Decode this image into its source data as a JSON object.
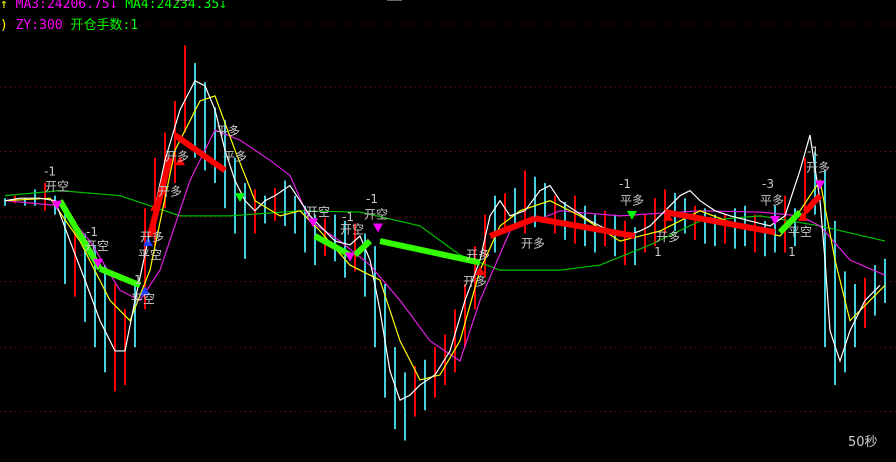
{
  "header": {
    "ma3_label": "MA3:24206.75",
    "ma3_arrow": "↓",
    "ma4_label": "MA4:24234.35",
    "ma4_arrow": "↓",
    "lead_arrow": "↑",
    "zy_label": "ZY:300",
    "lots_label": "开仓手数:1",
    "lead_paren": ")"
  },
  "colors": {
    "ma3": "#ff00ff",
    "ma4": "#00ff00",
    "lots": "#00ff00",
    "up": "#ff0000",
    "down": "#40d0e0",
    "grid": "#a00000"
  },
  "chart_data": {
    "type": "line",
    "title": "",
    "period_label": "50秒",
    "xlim": [
      0,
      88.6
    ],
    "ylim": [
      24059,
      24425
    ],
    "grid_prices": [
      24406,
      24356,
      24305,
      24253,
      24202,
      24150,
      24099
    ],
    "extremes": [
      {
        "label": "24389",
        "x": 18.5,
        "price": 24389
      },
      {
        "label": "24076",
        "x": 39.7,
        "price": 24076
      }
    ],
    "candles": [
      [
        0,
        24268,
        24262,
        "c"
      ],
      [
        1,
        24270,
        24264,
        "r"
      ],
      [
        2,
        24268,
        24262,
        "c"
      ],
      [
        3,
        24275,
        24262,
        "c"
      ],
      [
        4,
        24280,
        24258,
        "r"
      ],
      [
        5,
        24270,
        24255,
        "c"
      ],
      [
        6,
        24262,
        24200,
        "c"
      ],
      [
        7,
        24250,
        24190,
        "r"
      ],
      [
        8,
        24240,
        24170,
        "c"
      ],
      [
        9,
        24230,
        24150,
        "c"
      ],
      [
        10,
        24215,
        24130,
        "c"
      ],
      [
        11,
        24200,
        24115,
        "r"
      ],
      [
        12,
        24180,
        24120,
        "r"
      ],
      [
        13,
        24200,
        24150,
        "c"
      ],
      [
        14,
        24260,
        24180,
        "r"
      ],
      [
        15,
        24300,
        24230,
        "r"
      ],
      [
        16,
        24320,
        24260,
        "r"
      ],
      [
        17,
        24345,
        24280,
        "r"
      ],
      [
        18,
        24389,
        24320,
        "r"
      ],
      [
        19,
        24375,
        24300,
        "c"
      ],
      [
        20,
        24360,
        24290,
        "c"
      ],
      [
        21,
        24340,
        24280,
        "c"
      ],
      [
        22,
        24330,
        24260,
        "c"
      ],
      [
        23,
        24300,
        24240,
        "c"
      ],
      [
        24,
        24280,
        24220,
        "c"
      ],
      [
        25,
        24275,
        24240,
        "r"
      ],
      [
        26,
        24270,
        24248,
        "c"
      ],
      [
        27,
        24276,
        24250,
        "r"
      ],
      [
        28,
        24282,
        24246,
        "c"
      ],
      [
        29,
        24270,
        24240,
        "c"
      ],
      [
        30,
        24262,
        24225,
        "c"
      ],
      [
        31,
        24255,
        24215,
        "c"
      ],
      [
        32,
        24252,
        24222,
        "r"
      ],
      [
        33,
        24255,
        24218,
        "c"
      ],
      [
        34,
        24250,
        24205,
        "c"
      ],
      [
        35,
        24248,
        24210,
        "r"
      ],
      [
        36,
        24240,
        24190,
        "c"
      ],
      [
        37,
        24230,
        24150,
        "c"
      ],
      [
        38,
        24200,
        24110,
        "c"
      ],
      [
        39,
        24150,
        24085,
        "c"
      ],
      [
        40,
        24130,
        24076,
        "c"
      ],
      [
        41,
        24135,
        24095,
        "r"
      ],
      [
        42,
        24140,
        24100,
        "c"
      ],
      [
        43,
        24150,
        24110,
        "r"
      ],
      [
        44,
        24160,
        24120,
        "r"
      ],
      [
        45,
        24180,
        24130,
        "r"
      ],
      [
        46,
        24200,
        24150,
        "r"
      ],
      [
        47,
        24230,
        24180,
        "r"
      ],
      [
        48,
        24255,
        24205,
        "r"
      ],
      [
        49,
        24270,
        24225,
        "c"
      ],
      [
        50,
        24272,
        24240,
        "r"
      ],
      [
        51,
        24276,
        24245,
        "c"
      ],
      [
        52,
        24290,
        24240,
        "r"
      ],
      [
        53,
        24285,
        24245,
        "c"
      ],
      [
        54,
        24280,
        24250,
        "c"
      ],
      [
        55,
        24270,
        24240,
        "r"
      ],
      [
        56,
        24265,
        24235,
        "c"
      ],
      [
        57,
        24270,
        24232,
        "r"
      ],
      [
        58,
        24262,
        24230,
        "c"
      ],
      [
        59,
        24255,
        24225,
        "c"
      ],
      [
        60,
        24258,
        24230,
        "r"
      ],
      [
        61,
        24255,
        24222,
        "c"
      ],
      [
        62,
        24250,
        24215,
        "r"
      ],
      [
        63,
        24245,
        24215,
        "c"
      ],
      [
        64,
        24255,
        24225,
        "r"
      ],
      [
        65,
        24268,
        24230,
        "r"
      ],
      [
        66,
        24275,
        24240,
        "r"
      ],
      [
        67,
        24272,
        24242,
        "c"
      ],
      [
        68,
        24268,
        24240,
        "c"
      ],
      [
        69,
        24262,
        24235,
        "r"
      ],
      [
        70,
        24260,
        24232,
        "c"
      ],
      [
        71,
        24255,
        24230,
        "c"
      ],
      [
        72,
        24255,
        24232,
        "r"
      ],
      [
        73,
        24260,
        24228,
        "c"
      ],
      [
        74,
        24262,
        24230,
        "c"
      ],
      [
        75,
        24255,
        24225,
        "r"
      ],
      [
        76,
        24250,
        24222,
        "c"
      ],
      [
        77,
        24262,
        24225,
        "c"
      ],
      [
        78,
        24270,
        24225,
        "r"
      ],
      [
        79,
        24260,
        24230,
        "c"
      ],
      [
        80,
        24300,
        24250,
        "r"
      ],
      [
        81,
        24305,
        24255,
        "c"
      ],
      [
        82,
        24290,
        24150,
        "c"
      ],
      [
        83,
        24250,
        24120,
        "c"
      ],
      [
        84,
        24210,
        24130,
        "c"
      ],
      [
        85,
        24200,
        24150,
        "c"
      ],
      [
        86,
        24205,
        24165,
        "r"
      ],
      [
        87,
        24215,
        24175,
        "c"
      ],
      [
        88,
        24220,
        24185,
        "c"
      ]
    ],
    "series": [
      {
        "name": "price",
        "color": "#ffffff",
        "x": [
          0,
          1.5,
          3.5,
          5,
          6.5,
          8,
          9.5,
          11,
          12,
          13,
          14.5,
          16,
          17.5,
          19,
          20,
          21,
          22,
          23,
          24,
          25,
          26,
          27,
          28.5,
          29.5,
          30.5,
          31.5,
          33,
          34.5,
          35.5,
          36.5,
          37.5,
          38.5,
          39.5,
          40.5,
          41.5,
          43,
          44.5,
          46,
          47.5,
          48.5,
          49.5,
          50.5,
          52,
          53.5,
          54.5,
          55.5,
          57,
          58.5,
          60.5,
          62,
          63.5,
          64.5,
          66,
          67.5,
          68.5,
          69.5,
          71,
          72.5,
          74.5,
          76.5,
          78,
          79.5,
          80.5,
          81.5,
          82,
          82.5,
          83.5,
          84.5,
          86,
          87.5
        ],
        "y": [
          24266,
          24268,
          24268,
          24266,
          24234,
          24203,
          24171,
          24147,
          24147,
          24187,
          24242,
          24298,
          24338,
          24361,
          24357,
          24338,
          24306,
          24282,
          24266,
          24258,
          24266,
          24270,
          24278,
          24266,
          24254,
          24246,
          24234,
          24231,
          24238,
          24219,
          24179,
          24131,
          24108,
          24112,
          24120,
          24128,
          24147,
          24187,
          24219,
          24254,
          24266,
          24254,
          24258,
          24274,
          24278,
          24266,
          24258,
          24250,
          24242,
          24238,
          24242,
          24246,
          24258,
          24270,
          24274,
          24266,
          24258,
          24254,
          24250,
          24246,
          24254,
          24290,
          24318,
          24266,
          24219,
          24163,
          24139,
          24163,
          24187,
          24199
        ]
      },
      {
        "name": "yellow",
        "color": "#ffff00",
        "x": [
          0,
          4.5,
          7.5,
          10.5,
          12.5,
          14.5,
          17,
          19.5,
          21,
          23,
          25,
          27.5,
          29.5,
          31.5,
          34.5,
          37.5,
          39.5,
          41.5,
          43.5,
          45.5,
          47.5,
          49.5,
          51.5,
          54.5,
          57.5,
          61.5,
          65.5,
          69.5,
          73.5,
          77.5,
          79.5,
          81.5,
          83,
          84.5,
          86.5,
          88
        ],
        "y": [
          24266,
          24268,
          24234,
          24187,
          24171,
          24211,
          24306,
          24345,
          24349,
          24306,
          24266,
          24254,
          24258,
          24242,
          24215,
          24203,
          24155,
          24124,
          24128,
          24155,
          24211,
          24246,
          24258,
          24266,
          24254,
          24234,
          24242,
          24258,
          24246,
          24238,
          24258,
          24282,
          24219,
          24171,
          24187,
          24199
        ]
      },
      {
        "name": "magenta",
        "color": "#e020e0",
        "x": [
          0,
          5.5,
          8.5,
          11.5,
          13.5,
          15.5,
          18.5,
          21,
          23.5,
          26.5,
          28.5,
          30.5,
          33.5,
          36.5,
          39.5,
          42.5,
          45.5,
          47.5,
          50.5,
          55.5,
          61.5,
          69.5,
          75.5,
          79.5,
          81.5,
          84.5,
          88
        ],
        "y": [
          24266,
          24262,
          24234,
          24195,
          24187,
          24211,
          24282,
          24322,
          24314,
          24298,
          24286,
          24250,
          24234,
          24215,
          24187,
          24155,
          24139,
          24187,
          24242,
          24258,
          24254,
          24258,
          24257,
          24254,
          24246,
          24219,
          24207
        ]
      },
      {
        "name": "green",
        "color": "#00c000",
        "x": [
          0,
          5.5,
          11.5,
          17.5,
          22.5,
          29.5,
          35.5,
          41.5,
          45.5,
          49.5,
          55.5,
          59.5,
          64.5,
          69.5,
          75.5,
          81.5,
          88
        ],
        "y": [
          24270,
          24274,
          24270,
          24254,
          24254,
          24258,
          24257,
          24246,
          24223,
          24211,
          24211,
          24215,
          24231,
          24250,
          24254,
          24246,
          24234
        ]
      }
    ],
    "trade_segments": [
      {
        "side": "short",
        "x": [
          5.5,
          9.5
        ],
        "y": [
          24266,
          24212
        ]
      },
      {
        "side": "short",
        "x": [
          9.5,
          13.5
        ],
        "y": [
          24212,
          24199
        ]
      },
      {
        "side": "long",
        "x": [
          14.5,
          16.5
        ],
        "y": [
          24238,
          24300
        ]
      },
      {
        "side": "long",
        "x": [
          17,
          22
        ],
        "y": [
          24318,
          24290
        ]
      },
      {
        "side": "short",
        "x": [
          31,
          34.5
        ],
        "y": [
          24238,
          24223
        ]
      },
      {
        "side": "short",
        "x": [
          35,
          36.5
        ],
        "y": [
          24223,
          24234
        ]
      },
      {
        "side": "short",
        "x": [
          37.5,
          47.5
        ],
        "y": [
          24234,
          24217
        ]
      },
      {
        "side": "long",
        "x": [
          48.5,
          53
        ],
        "y": [
          24238,
          24252
        ]
      },
      {
        "side": "long",
        "x": [
          53,
          63
        ],
        "y": [
          24252,
          24238
        ]
      },
      {
        "side": "long",
        "x": [
          66,
          77
        ],
        "y": [
          24257,
          24241
        ]
      },
      {
        "side": "short",
        "x": [
          77.5,
          79.5
        ],
        "y": [
          24241,
          24257
        ]
      },
      {
        "side": "long",
        "x": [
          80,
          81.5
        ],
        "y": [
          24257,
          24270
        ]
      }
    ],
    "markers": [
      {
        "shape": "down",
        "color": "#ff00ff",
        "x": 5.2,
        "y": 24262
      },
      {
        "shape": "down",
        "color": "#ff00ff",
        "x": 9.3,
        "y": 24216
      },
      {
        "shape": "up",
        "color": "#2040ff",
        "x": 14,
        "y": 24195
      },
      {
        "shape": "up",
        "color": "#2040ff",
        "x": 14.3,
        "y": 24234
      },
      {
        "shape": "up",
        "color": "#ff0000",
        "x": 15,
        "y": 24262
      },
      {
        "shape": "up",
        "color": "#ff0000",
        "x": 17.5,
        "y": 24298
      },
      {
        "shape": "down",
        "color": "#00ff00",
        "x": 23.5,
        "y": 24268
      },
      {
        "shape": "down",
        "color": "#ff00ff",
        "x": 30.8,
        "y": 24248
      },
      {
        "shape": "down",
        "color": "#ff00ff",
        "x": 34.5,
        "y": 24221
      },
      {
        "shape": "down",
        "color": "#ff00ff",
        "x": 37.3,
        "y": 24244
      },
      {
        "shape": "up",
        "color": "#ff0000",
        "x": 47.5,
        "y": 24211
      },
      {
        "shape": "down",
        "color": "#00ff00",
        "x": 62.7,
        "y": 24254
      },
      {
        "shape": "up",
        "color": "#ff0000",
        "x": 66.3,
        "y": 24254
      },
      {
        "shape": "down",
        "color": "#ff00ff",
        "x": 77,
        "y": 24250
      },
      {
        "shape": "up",
        "color": "#ff0000",
        "x": 79.8,
        "y": 24254
      },
      {
        "shape": "down",
        "color": "#ff00ff",
        "x": 81.5,
        "y": 24278
      }
    ],
    "annotations": [
      {
        "text": "-1",
        "x": 4.5,
        "y": 24286
      },
      {
        "text": "开空",
        "x": 5.2,
        "y": 24274
      },
      {
        "text": "-1",
        "x": 8.7,
        "y": 24238
      },
      {
        "text": "开空",
        "x": 9.2,
        "y": 24227
      },
      {
        "text": "1",
        "x": 13.3,
        "y": 24200
      },
      {
        "text": "平空",
        "x": 13.8,
        "y": 24185
      },
      {
        "text": "开多",
        "x": 14.7,
        "y": 24234
      },
      {
        "text": "平空",
        "x": 14.5,
        "y": 24220
      },
      {
        "text": "开多",
        "x": 16.5,
        "y": 24270
      },
      {
        "text": "开多",
        "x": 17.2,
        "y": 24298
      },
      {
        "text": "平多",
        "x": 22.3,
        "y": 24318
      },
      {
        "text": "平多",
        "x": 23,
        "y": 24298
      },
      {
        "text": "开空",
        "x": 31.3,
        "y": 24254
      },
      {
        "text": "-1",
        "x": 34.3,
        "y": 24250
      },
      {
        "text": "开空",
        "x": 34.7,
        "y": 24240
      },
      {
        "text": "-1",
        "x": 36.7,
        "y": 24264
      },
      {
        "text": "开空",
        "x": 37.1,
        "y": 24252
      },
      {
        "text": "开多",
        "x": 47.3,
        "y": 24220
      },
      {
        "text": "开多",
        "x": 47,
        "y": 24199
      },
      {
        "text": "开多",
        "x": 52.8,
        "y": 24229
      },
      {
        "text": "-1",
        "x": 62,
        "y": 24276
      },
      {
        "text": "平多",
        "x": 62.7,
        "y": 24263
      },
      {
        "text": "开多",
        "x": 66.3,
        "y": 24234
      },
      {
        "text": "1",
        "x": 65.3,
        "y": 24222
      },
      {
        "text": "-3",
        "x": 76.3,
        "y": 24276
      },
      {
        "text": "平多",
        "x": 76.7,
        "y": 24263
      },
      {
        "text": "平空",
        "x": 79.5,
        "y": 24238
      },
      {
        "text": "1",
        "x": 78.7,
        "y": 24222
      },
      {
        "text": "-1",
        "x": 80.8,
        "y": 24302
      },
      {
        "text": "开多",
        "x": 81.3,
        "y": 24289
      }
    ]
  }
}
